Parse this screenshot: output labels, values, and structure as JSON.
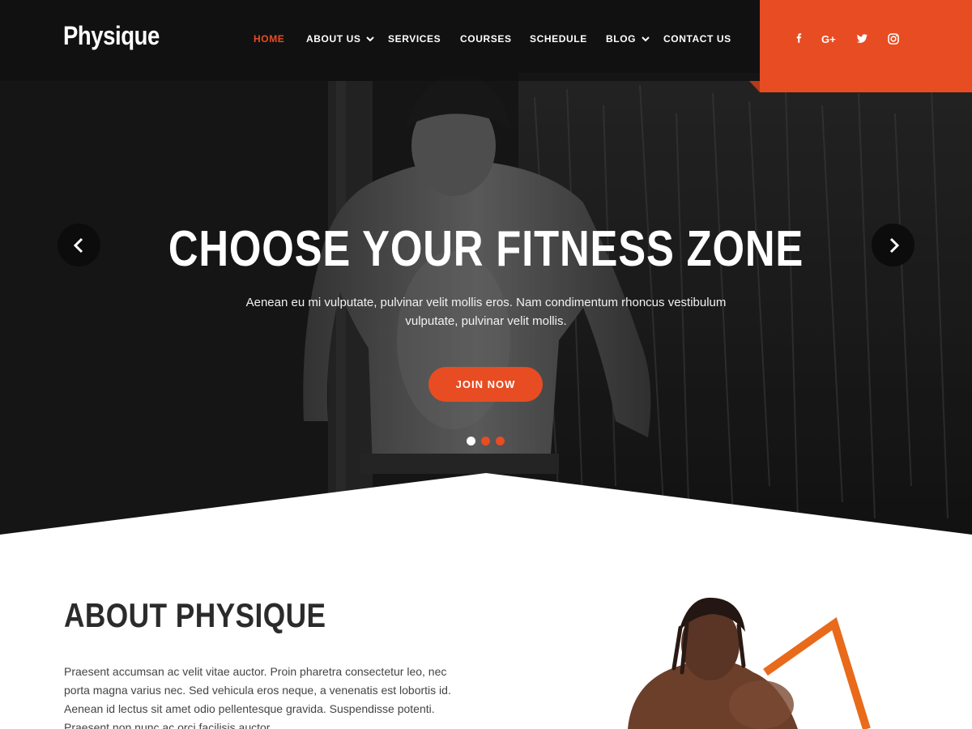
{
  "brand": {
    "logo": "Physique",
    "accent": "#e84c22"
  },
  "nav": {
    "items": [
      {
        "label": "HOME",
        "active": true
      },
      {
        "label": "ABOUT US",
        "dropdown": true
      },
      {
        "label": "SERVICES"
      },
      {
        "label": "COURSES"
      },
      {
        "label": "SCHEDULE"
      },
      {
        "label": "BLOG",
        "dropdown": true
      },
      {
        "label": "CONTACT US"
      }
    ]
  },
  "social": [
    "facebook-icon",
    "google-plus-icon",
    "twitter-icon",
    "instagram-icon"
  ],
  "hero": {
    "title": "CHOOSE YOUR FITNESS ZONE",
    "text": "Aenean eu mi vulputate, pulvinar velit mollis eros. Nam condimentum rhoncus vestibulum vulputate, pulvinar velit mollis.",
    "cta": "JOIN NOW",
    "slides": 3,
    "active_slide": 1
  },
  "about": {
    "title": "ABOUT PHYSIQUE",
    "text": "Praesent accumsan ac velit vitae auctor. Proin pharetra consectetur leo, nec porta magna varius nec. Sed vehicula eros neque, a venenatis est lobortis id. Aenean id lectus sit amet odio pellentesque gravida. Suspendisse potenti. Praesent non nunc ac orci facilisis auctor."
  }
}
